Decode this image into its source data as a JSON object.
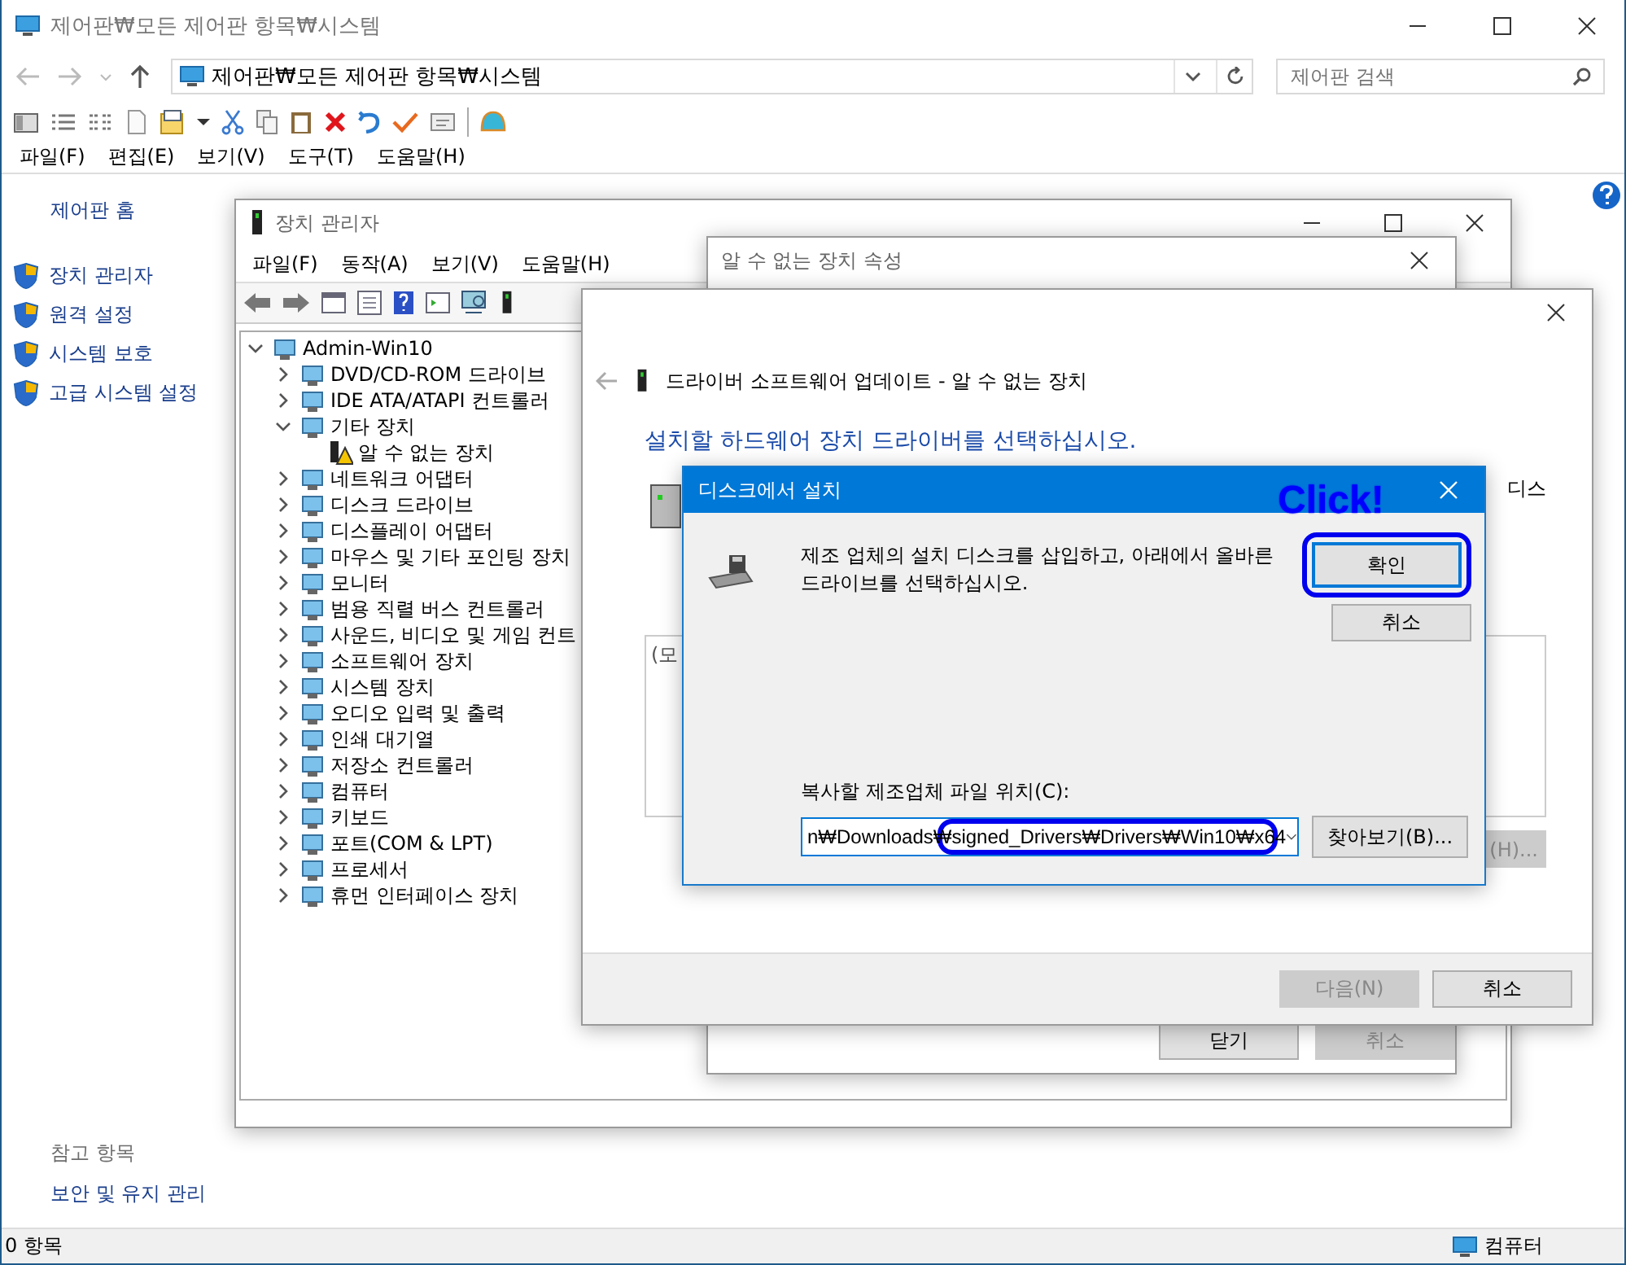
{
  "window": {
    "title": "제어판₩모든 제어판 항목₩시스템"
  },
  "address": {
    "value": "제어판₩모든 제어판 항목₩시스템"
  },
  "search": {
    "placeholder": "제어판 검색"
  },
  "menu": [
    "파일(F)",
    "편집(E)",
    "보기(V)",
    "도구(T)",
    "도움말(H)"
  ],
  "sidebar": {
    "home": "제어판 홈",
    "links": [
      "장치 관리자",
      "원격 설정",
      "시스템 보호",
      "고급 시스템 설정"
    ],
    "see_also_title": "참고 항목",
    "see_also": [
      "보안 및 유지 관리"
    ]
  },
  "status_bar": {
    "count": "0 항목",
    "location": "컴퓨터"
  },
  "device_manager": {
    "title": "장치 관리자",
    "menu": [
      "파일(F)",
      "동작(A)",
      "보기(V)",
      "도움말(H)"
    ],
    "tree": {
      "label": "Admin-Win10",
      "expanded": true,
      "children": [
        {
          "label": "DVD/CD-ROM 드라이브",
          "expanded": false
        },
        {
          "label": "IDE ATA/ATAPI 컨트롤러",
          "expanded": false
        },
        {
          "label": "기타 장치",
          "expanded": true,
          "children": [
            {
              "label": "알 수 없는 장치",
              "problem": true
            }
          ]
        },
        {
          "label": "네트워크 어댑터",
          "expanded": false
        },
        {
          "label": "디스크 드라이브",
          "expanded": false
        },
        {
          "label": "디스플레이 어댑터",
          "expanded": false
        },
        {
          "label": "마우스 및 기타 포인팅 장치",
          "expanded": false
        },
        {
          "label": "모니터",
          "expanded": false
        },
        {
          "label": "범용 직렬 버스 컨트롤러",
          "expanded": false
        },
        {
          "label": "사운드, 비디오 및 게임 컨트",
          "expanded": false
        },
        {
          "label": "소프트웨어 장치",
          "expanded": false
        },
        {
          "label": "시스템 장치",
          "expanded": false
        },
        {
          "label": "오디오 입력 및 출력",
          "expanded": false
        },
        {
          "label": "인쇄 대기열",
          "expanded": false
        },
        {
          "label": "저장소 컨트롤러",
          "expanded": false
        },
        {
          "label": "컴퓨터",
          "expanded": false
        },
        {
          "label": "키보드",
          "expanded": false
        },
        {
          "label": "포트(COM & LPT)",
          "expanded": false
        },
        {
          "label": "프로세서",
          "expanded": false
        },
        {
          "label": "휴먼 인터페이스 장치",
          "expanded": false
        }
      ]
    }
  },
  "properties": {
    "title": "알 수 없는 장치 속성",
    "buttons": [
      {
        "label": "닫기",
        "disabled": false
      },
      {
        "label": "취소",
        "disabled": true
      }
    ]
  },
  "wizard": {
    "title": "드라이버 소프트웨어 업데이트 - 알 수 없는 장치",
    "heading": "설치할 하드웨어 장치 드라이버를 선택하십시오.",
    "side_text": "디스",
    "list_text": "(모",
    "disk_button": {
      "label": "(H)...",
      "disabled": true
    },
    "buttons": [
      {
        "label": "다음(N)",
        "disabled": true
      },
      {
        "label": "취소",
        "disabled": false
      }
    ]
  },
  "disk_dialog": {
    "title": "디스크에서 설치",
    "message": "제조 업체의 설치 디스크를 삽입하고, 아래에서 올바른 드라이브를 선택하십시오.",
    "ok": "확인",
    "cancel": "취소",
    "path_label": "복사할 제조업체 파일 위치(C):",
    "path_value": "n₩Downloads₩signed_Drivers₩Drivers₩Win10₩x64",
    "browse": "찾아보기(B)..."
  },
  "annotation": {
    "label": "Click!"
  }
}
